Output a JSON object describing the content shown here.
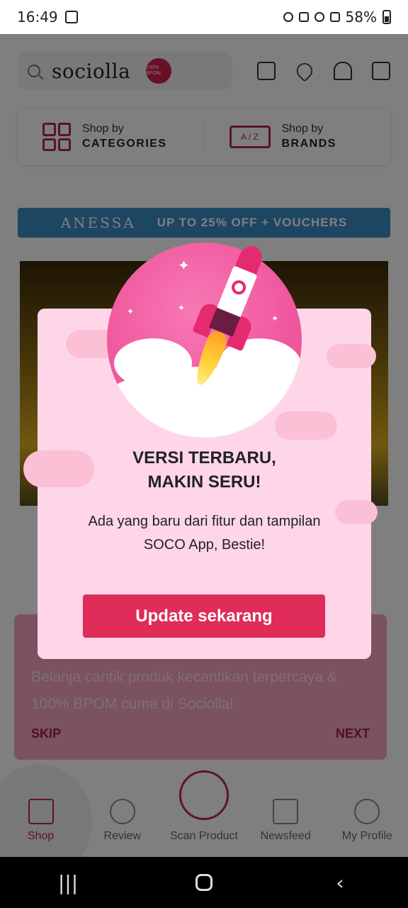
{
  "status_bar": {
    "time": "16:49",
    "battery": "58%"
  },
  "app": {
    "logo": "sociolla",
    "bpom_badge": "100% BPOM",
    "shop_by": [
      {
        "prefix": "Shop by",
        "label": "CATEGORIES"
      },
      {
        "prefix": "Shop by",
        "label": "BRANDS"
      }
    ],
    "az_label": "A / Z",
    "banner": {
      "brand": "ANESSA",
      "promo": "UP TO 25% OFF + VOUCHERS"
    },
    "onboarding": {
      "text": "Belanja cantik produk kecantikan terpercaya & 100% BPOM cuma di Sociolla!",
      "skip": "SKIP",
      "next": "NEXT"
    },
    "bottom_nav": [
      {
        "label": "Shop"
      },
      {
        "label": "Review"
      },
      {
        "label": "Scan Product"
      },
      {
        "label": "Newsfeed"
      },
      {
        "label": "My Profile"
      }
    ]
  },
  "modal": {
    "title_line1": "VERSI TERBARU,",
    "title_line2": "MAKIN SERU!",
    "desc_line1": "Ada yang baru dari fitur dan tampilan",
    "desc_line2": "SOCO App, Bestie!",
    "button": "Update sekarang"
  },
  "colors": {
    "brand": "#e02c58",
    "modal_bg": "#ffd6e8",
    "banner": "#3a8dc5"
  }
}
